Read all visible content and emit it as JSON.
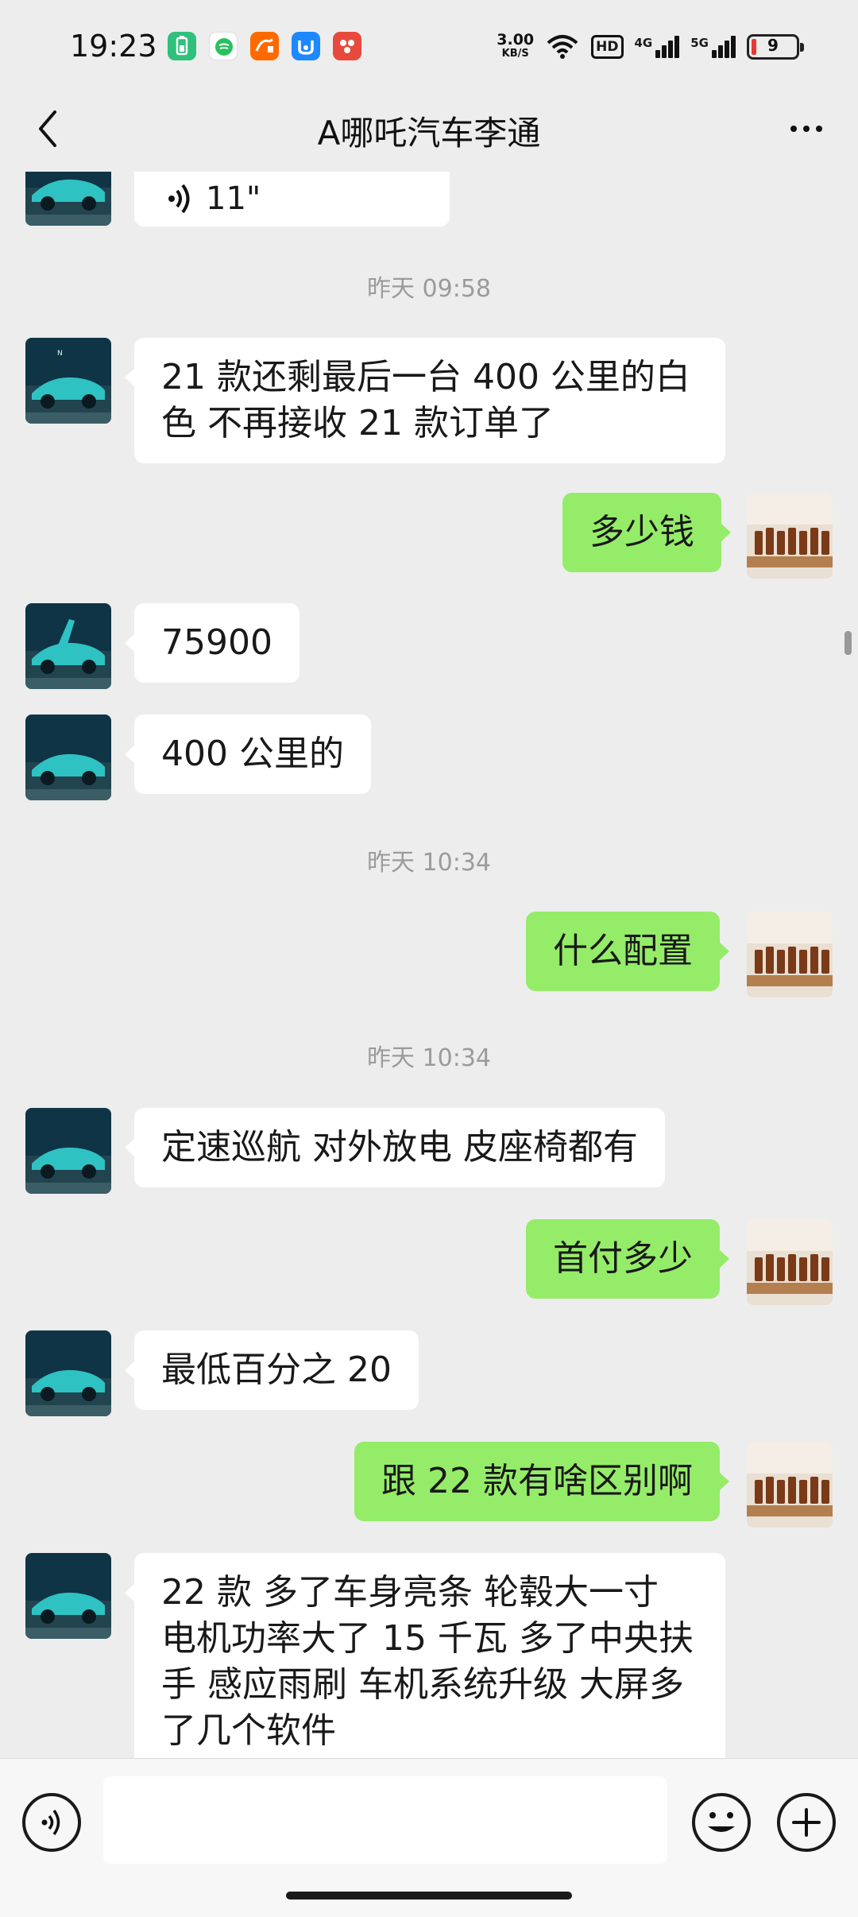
{
  "status_bar": {
    "time": "19:23",
    "net_speed_value": "3.00",
    "net_speed_unit": "KB/S",
    "hd_label": "HD",
    "sig1_label": "4G",
    "sig2_label": "5G",
    "battery_level": "9",
    "app_icons": [
      "battery-saver-icon",
      "messaging-app-icon",
      "shopping-app-icon",
      "tasks-app-icon",
      "photo-app-icon"
    ]
  },
  "nav": {
    "title": "A哪吒汽车李通"
  },
  "messages": [
    {
      "side": "in",
      "text": "21 款还剩最后一台 400 公里的白色  不再接收 21 款订单了"
    },
    {
      "side": "out",
      "text": "多少钱"
    },
    {
      "side": "in",
      "text": "75900"
    },
    {
      "side": "in",
      "text": "400 公里的"
    },
    {
      "side": "out",
      "text": "什么配置"
    },
    {
      "side": "in",
      "text": "定速巡航 对外放电 皮座椅都有"
    },
    {
      "side": "out",
      "text": "首付多少"
    },
    {
      "side": "in",
      "text": "最低百分之 20"
    },
    {
      "side": "out",
      "text": "跟 22 款有啥区别啊"
    },
    {
      "side": "in",
      "text": "22 款 多了车身亮条 轮毂大一寸 电机功率大了 15 千瓦 多了中央扶手 感应雨刷 车机系统升级 大屏多了几个软件"
    }
  ],
  "timestamps": [
    "昨天 09:58",
    "昨天 10:34",
    "昨天 10:34"
  ],
  "voice_partial": "11\"",
  "colors": {
    "background": "#ededed",
    "bubble_in": "#ffffff",
    "bubble_out": "#95ec69",
    "timestamp": "#9b9b9b"
  }
}
